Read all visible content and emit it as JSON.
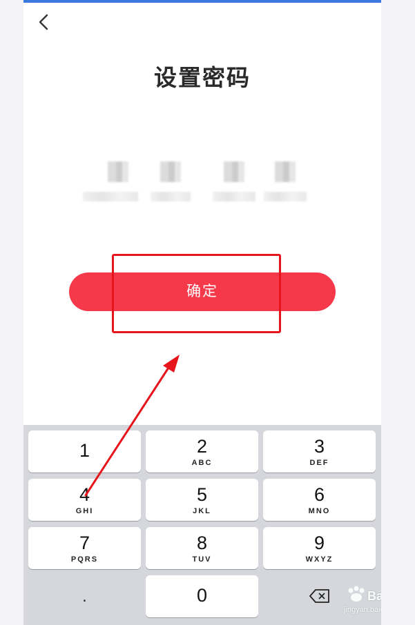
{
  "header": {
    "title": "设置密码",
    "back_icon": "chevron-left-icon"
  },
  "password": {
    "slots": 4
  },
  "confirm": {
    "label": "确定",
    "color": "#f5394b"
  },
  "annotation": {
    "box_color": "#e8141c",
    "arrow_color": "#e8141c"
  },
  "keypad": {
    "keys": [
      {
        "num": "1",
        "letters": ""
      },
      {
        "num": "2",
        "letters": "ABC"
      },
      {
        "num": "3",
        "letters": "DEF"
      },
      {
        "num": "4",
        "letters": "GHI"
      },
      {
        "num": "5",
        "letters": "JKL"
      },
      {
        "num": "6",
        "letters": "MNO"
      },
      {
        "num": "7",
        "letters": "PQRS"
      },
      {
        "num": "8",
        "letters": "TUV"
      },
      {
        "num": "9",
        "letters": "WXYZ"
      },
      {
        "num": "0",
        "letters": ""
      }
    ],
    "dot": ".",
    "delete_icon": "backspace-icon"
  },
  "watermark": {
    "brand": "Bai经验",
    "url": "jingyan.baidu.com"
  }
}
